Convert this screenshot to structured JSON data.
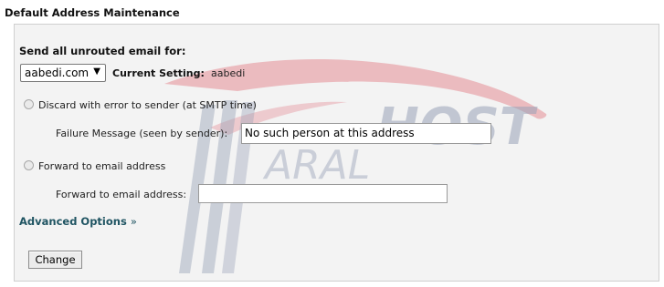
{
  "page": {
    "title": "Default Address Maintenance"
  },
  "form": {
    "section_label": "Send all unrouted email for:",
    "domain_select": {
      "selected": "aabedi.com"
    },
    "current_setting_label": "Current Setting:",
    "current_setting_value": "aabedi",
    "options": [
      {
        "label": "Discard with error to sender (at SMTP time)",
        "selected": false
      },
      {
        "label": "Forward to email address",
        "selected": false
      }
    ],
    "failure_message": {
      "label": "Failure Message (seen by sender):",
      "value": "No such person at this address"
    },
    "forward_address": {
      "label": "Forward to email address:",
      "value": ""
    },
    "advanced_options": "Advanced Options",
    "advanced_icon": "double-chevron-right-icon",
    "change_button": "Change"
  },
  "watermark": {
    "text_host": "HOST",
    "text_aral": "ARAL",
    "colors": {
      "swoosh": "#e8a8ae",
      "text": "#9aa3b8"
    }
  }
}
